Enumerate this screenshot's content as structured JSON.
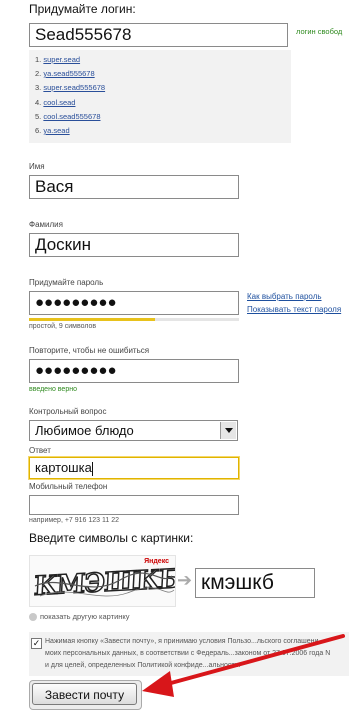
{
  "login": {
    "heading": "Придумайте логин:",
    "value": "Sead555678",
    "status": "логин свобод",
    "suggestions": [
      {
        "num": "1.",
        "text": "super.sead"
      },
      {
        "num": "2.",
        "text": "ya.sead555678"
      },
      {
        "num": "3.",
        "text": "super.sead555678"
      },
      {
        "num": "4.",
        "text": "cool.sead"
      },
      {
        "num": "5.",
        "text": "cool.sead555678"
      },
      {
        "num": "6.",
        "text": "ya.sead"
      }
    ]
  },
  "first_name": {
    "label": "Имя",
    "value": "Вася"
  },
  "last_name": {
    "label": "Фамилия",
    "value": "Доскин"
  },
  "password": {
    "label": "Придумайте пароль",
    "value": "●●●●●●●●●",
    "strength_text": "простой, 9 символов",
    "strength_level": 0.6,
    "link_choose": "Как выбрать пароль",
    "link_show": "Показывать текст пароля"
  },
  "password_repeat": {
    "label": "Повторите, чтобы не ошибиться",
    "value": "●●●●●●●●●",
    "status": "введено верно"
  },
  "security_question": {
    "label": "Контрольный вопрос",
    "selected": "Любимое блюдо"
  },
  "answer": {
    "label": "Ответ",
    "value": "картошка"
  },
  "phone": {
    "label": "Мобильный телефон",
    "value": "",
    "hint": "например, +7 916 123 11 22"
  },
  "captcha": {
    "heading": "Введите символы с картинки:",
    "image_text": "КМЭШКБ",
    "brand": "Яндекс",
    "arrow": "➔",
    "value": "кмэшкб",
    "refresh_label": "показать другую картинку"
  },
  "agreement": {
    "checked": true,
    "line1": "Нажимая кнопку «Завести почту», я принимаю условия Пользо...льского соглашени",
    "line2": "моих персональных данных, в соответствии с Федераль...законом от 27.07.2006 года N",
    "line3": "и для целей, определенных Политикой конфиде...альности."
  },
  "submit": {
    "label": "Завести почту"
  },
  "colors": {
    "accent_link": "#1d4f9e",
    "ok_green": "#2f8a1f",
    "strength_yellow": "#e8c21c",
    "arrow_red": "#d8161a"
  }
}
